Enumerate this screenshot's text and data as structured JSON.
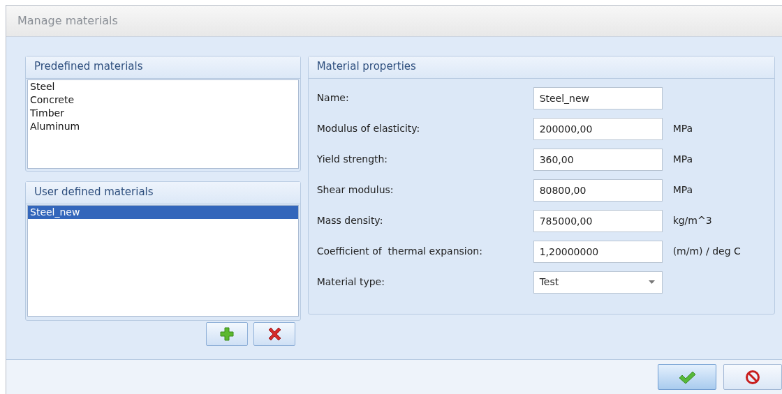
{
  "window": {
    "title": "Manage materials"
  },
  "predefined": {
    "title": "Predefined materials",
    "items": [
      {
        "label": "Steel",
        "selected": false
      },
      {
        "label": "Concrete",
        "selected": false
      },
      {
        "label": "Timber",
        "selected": false
      },
      {
        "label": "Aluminum",
        "selected": false
      }
    ]
  },
  "user_defined": {
    "title": "User defined materials",
    "items": [
      {
        "label": "Steel_new",
        "selected": true
      }
    ]
  },
  "list_buttons": [
    {
      "kind": "add"
    },
    {
      "kind": "delete"
    }
  ],
  "properties": {
    "title": "Material properties",
    "rows": [
      {
        "kind": "text",
        "label": "Name:",
        "value": "Steel_new"
      },
      {
        "kind": "text",
        "label": "Modulus of elasticity:",
        "value": "200000,00",
        "unit": "MPa"
      },
      {
        "kind": "text",
        "label": "Yield strength:",
        "value": "360,00",
        "unit": "MPa"
      },
      {
        "kind": "text",
        "label": "Shear modulus:",
        "value": "80800,00",
        "unit": "MPa"
      },
      {
        "kind": "text",
        "label": "Mass density:",
        "value": "785000,00",
        "unit": "kg/m^3"
      },
      {
        "kind": "text",
        "label": "Coefficient of  thermal expansion:",
        "value": "1,20000000",
        "unit": "(m/m) / deg C"
      },
      {
        "kind": "select",
        "label": "Material type:",
        "value": "Test"
      }
    ]
  },
  "footer_buttons": [
    {
      "kind": "ok",
      "focused": true
    },
    {
      "kind": "cancel",
      "focused": false
    }
  ]
}
